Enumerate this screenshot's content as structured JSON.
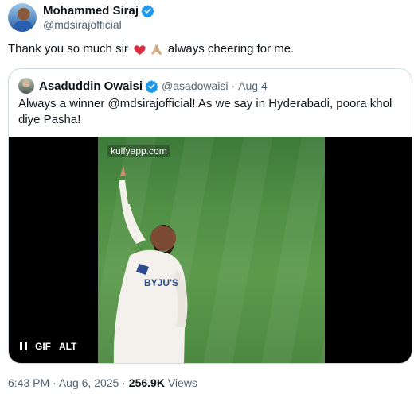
{
  "author": {
    "display_name": "Mohammed Siraj",
    "handle": "@mdsirajofficial"
  },
  "tweet": {
    "text_before": "Thank you so much sir",
    "text_after": "always cheering for me.",
    "emojis": [
      "red-heart-icon",
      "folded-hands-icon"
    ]
  },
  "quoted_tweet": {
    "display_name": "Asaduddin Owaisi",
    "handle": "@asadowaisi",
    "separator": "·",
    "date": "Aug 4",
    "text": "Always a winner @mdsirajofficial! As we say in Hyderabadi, poora khol diye Pasha!",
    "media": {
      "watermark": "kulfyapp.com",
      "gif_label": "GIF",
      "alt_label": "ALT"
    }
  },
  "meta": {
    "time": "6:43 PM",
    "separator": "·",
    "date": "Aug 6, 2025",
    "views_count": "256.9K",
    "views_label": "Views"
  },
  "colors": {
    "verified_blue": "#1d9bf0",
    "secondary_text": "#536471",
    "border": "#cfd9de"
  }
}
